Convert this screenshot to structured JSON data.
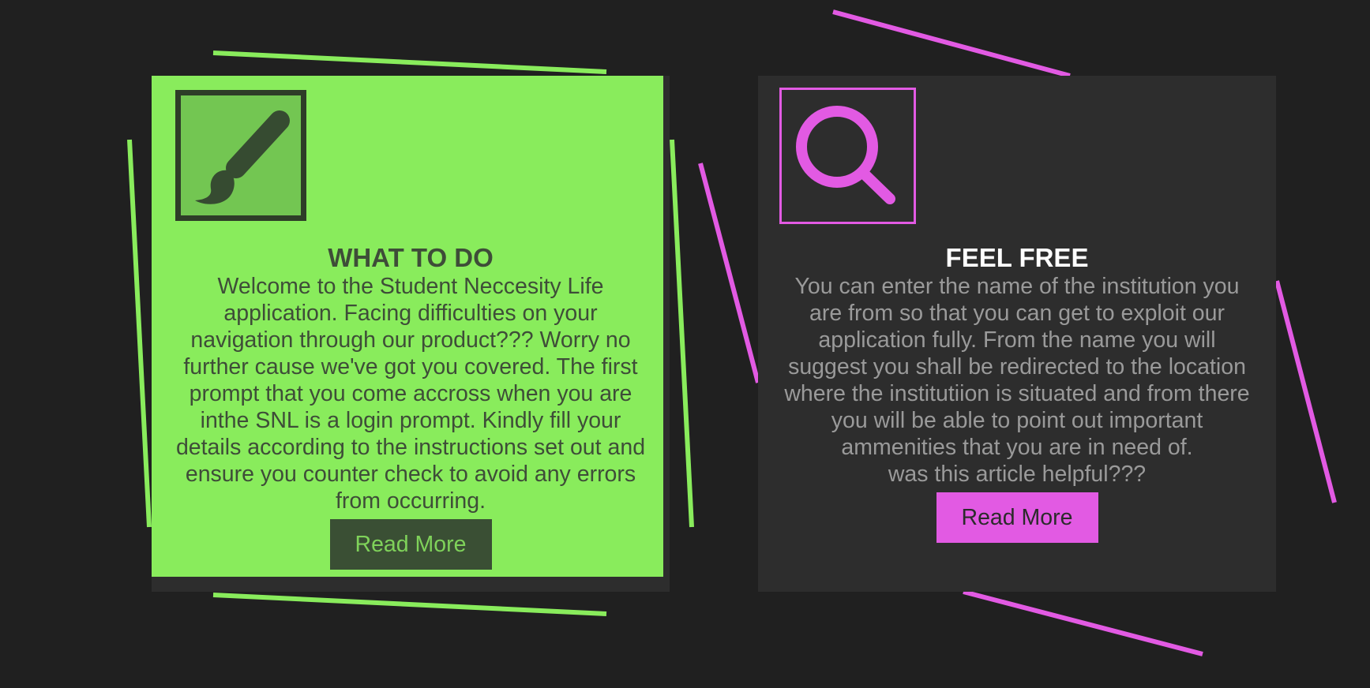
{
  "colors": {
    "background": "#202020",
    "green_accent": "#89ec5c",
    "magenta_accent": "#e25ae3",
    "card_dark": "#2d2d2d"
  },
  "cards": [
    {
      "icon": "paintbrush-icon",
      "title": "WHAT TO DO",
      "body": "Welcome to the Student Neccesity Life application. Facing difficulties on your navigation through our product??? Worry no further cause we've got you covered. The first prompt that you come accross when you are inthe SNL is a login prompt. Kindly fill your details according to the instructions set out and ensure you counter check to avoid any errors from occurring.",
      "button_label": "Read More"
    },
    {
      "icon": "search-icon",
      "title": "FEEL FREE",
      "body": "You can enter the name of the institution you are from so that you can get to exploit our application fully. From the name you will suggest you shall be redirected to the location where the institutiion is situated and from there you will be able to point out important ammenities that you are in need of.",
      "footer_question": "was this article helpful???",
      "button_label": "Read More"
    }
  ]
}
